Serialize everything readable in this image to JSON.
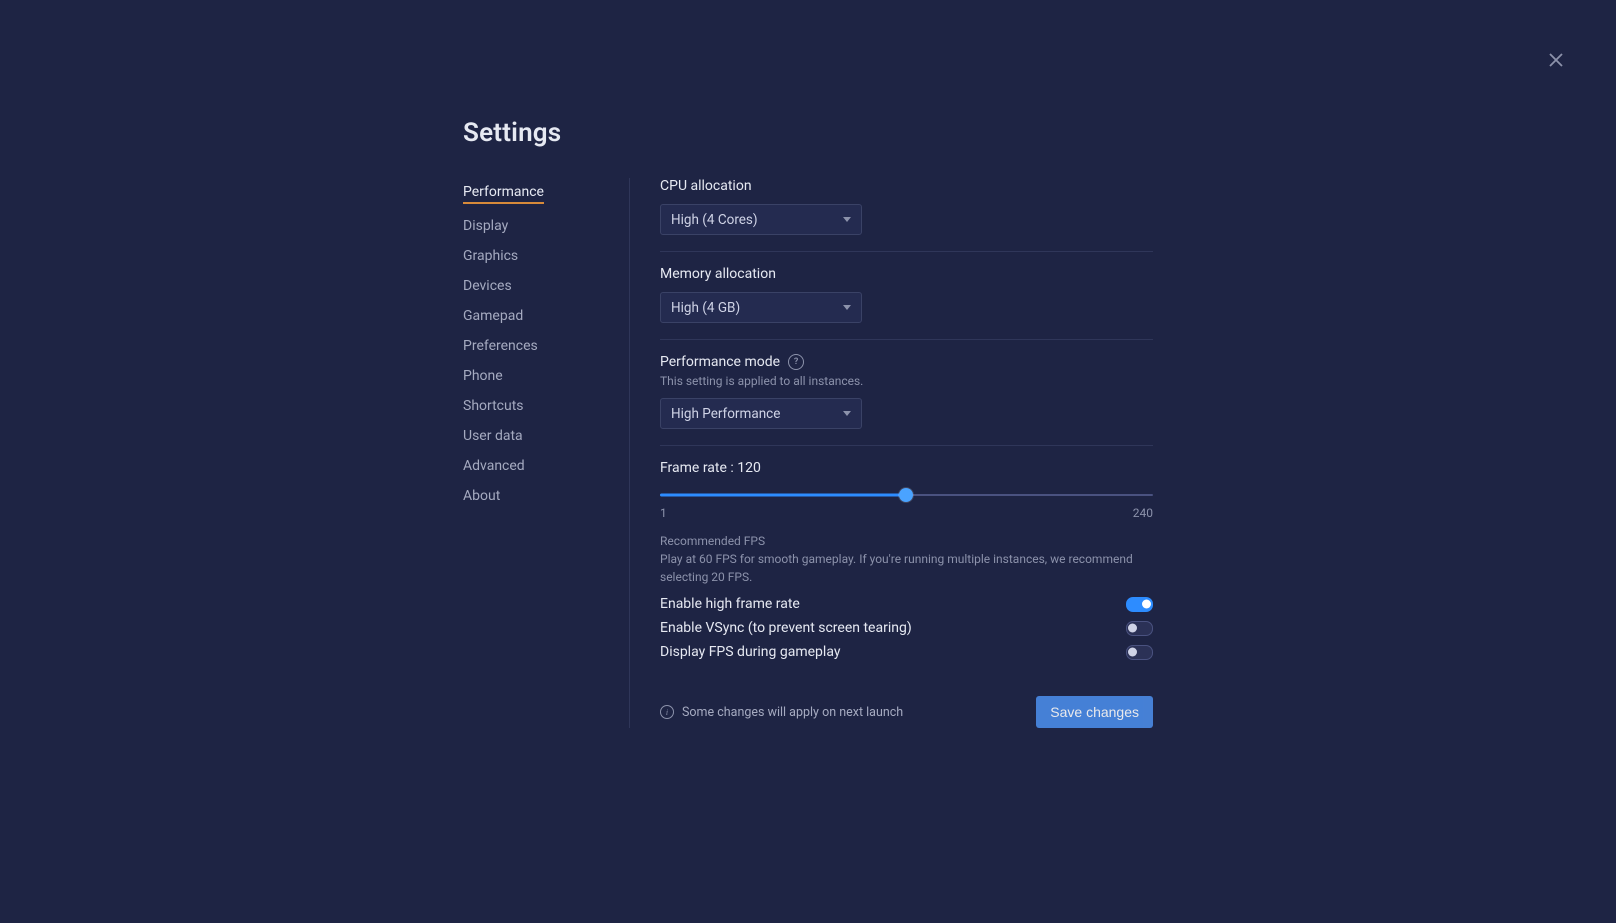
{
  "title": "Settings",
  "close_icon": "close",
  "sidebar": {
    "items": [
      {
        "label": "Performance",
        "active": true
      },
      {
        "label": "Display"
      },
      {
        "label": "Graphics"
      },
      {
        "label": "Devices"
      },
      {
        "label": "Gamepad"
      },
      {
        "label": "Preferences"
      },
      {
        "label": "Phone"
      },
      {
        "label": "Shortcuts"
      },
      {
        "label": "User data"
      },
      {
        "label": "Advanced"
      },
      {
        "label": "About"
      }
    ]
  },
  "cpu": {
    "label": "CPU allocation",
    "value": "High (4 Cores)"
  },
  "memory": {
    "label": "Memory allocation",
    "value": "High (4 GB)"
  },
  "perf_mode": {
    "label": "Performance mode",
    "note": "This setting is applied to all instances.",
    "value": "High Performance"
  },
  "frame_rate": {
    "label_prefix": "Frame rate : ",
    "value": 120,
    "min": 1,
    "max": 240,
    "min_label": "1",
    "max_label": "240",
    "percent": 49.8
  },
  "recommended": {
    "title": "Recommended FPS",
    "text": "Play at 60 FPS for smooth gameplay. If you're running multiple instances, we recommend selecting 20 FPS."
  },
  "toggles": {
    "high_frame": {
      "label": "Enable high frame rate",
      "on": true
    },
    "vsync": {
      "label": "Enable VSync (to prevent screen tearing)",
      "on": false
    },
    "display_fps": {
      "label": "Display FPS during gameplay",
      "on": false
    }
  },
  "footer": {
    "note": "Some changes will apply on next launch",
    "save": "Save changes"
  }
}
